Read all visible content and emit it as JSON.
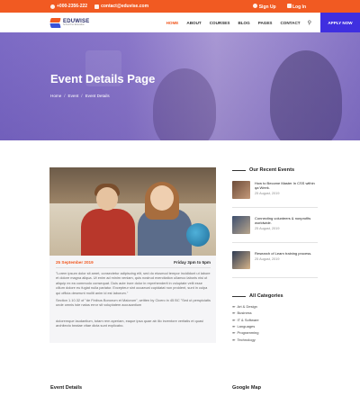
{
  "topbar": {
    "phone": "+000-2356-222",
    "email": "contact@eduvise.com",
    "signup": "Sign Up",
    "login": "Log In"
  },
  "brand": {
    "name": "EDUWISE",
    "tagline": "School For Education",
    "orange": "#f15a22",
    "blue": "#3f2fe0"
  },
  "nav": {
    "items": [
      "HOME",
      "ABOUT",
      "COURSES",
      "BLOG",
      "PAGES",
      "CONTACT"
    ],
    "active": "HOME",
    "search_icon": "search-icon",
    "apply": "APPLY NOW"
  },
  "hero": {
    "title": "Event Details Page",
    "breadcrumb": [
      "Home",
      "Event",
      "Event Details"
    ]
  },
  "event": {
    "date": "25 September 2019",
    "time": "Friday 3pm to 5pm",
    "para1": "\"Lorem ipsum dolor sit amet, consectetur adipiscing elit, sed do eiusmod tempor incididunt ut labore et dolore magna aliqua. Ut enim ad minim veniam, quis nostrud exercitation ullamco laboris nisi ut aliquip ex ea commodo consequat. Duis aute irure dolor in reprehenderit in voluptate velit esse cillum dolore eu fugiat nulla pariatur. Excepteur sint occaecat cupidatat non proident, sunt in culpa qui officia deserunt mollit anim id est laborum.\"",
    "para2": "Section 1.10.32 of \"de Finibus Bonorum et Malorum\", written by Cicero in 45 BC \"Sed ut perspiciatis unde omnis iste natus error sit voluptatem accusantium",
    "para3": "doloremque laudantium, totam rem aperiam, eaque ipsa quae ab illo inventore veritatis et quasi architecto beatae vitae dicta sunt explicabo."
  },
  "sidebar": {
    "recent_title": "Our Recent Events",
    "recent": [
      {
        "title": "How to Become Master In CSS within qa Week.",
        "date": "25 August, 2019"
      },
      {
        "title": "Connecting volunteers & nonprofits worldwide.",
        "date": "25 August, 2019"
      },
      {
        "title": "Research of Learn training process.",
        "date": "25 August, 2019"
      }
    ],
    "categories_title": "All Categories",
    "categories": [
      "Art & Design",
      "Business",
      "IT & Software",
      "Languages",
      "Programming",
      "Technology"
    ]
  },
  "bottom": {
    "details": "Event Details",
    "map": "Google Map"
  }
}
